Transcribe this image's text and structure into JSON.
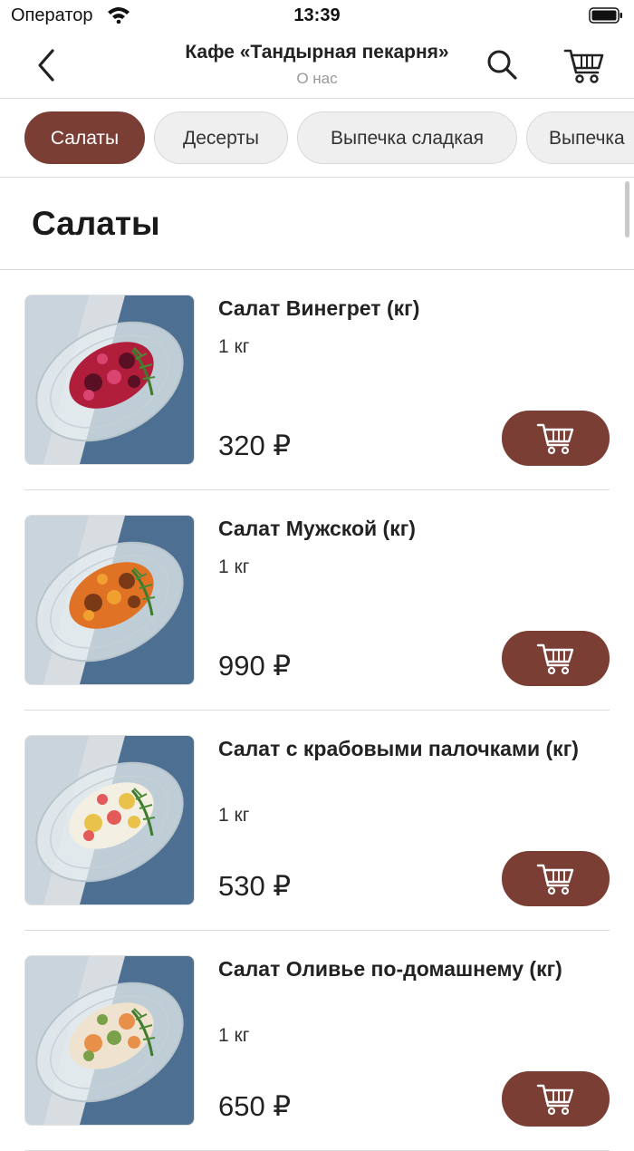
{
  "status_bar": {
    "carrier": "Оператор",
    "time": "13:39"
  },
  "header": {
    "title": "Кафе «Тандырная пекарня»",
    "subtitle": "О нас"
  },
  "tabs": [
    "Салаты",
    "Десерты",
    "Выпечка сладкая",
    "Выпечка"
  ],
  "section": {
    "title": "Салаты"
  },
  "products": [
    {
      "name": "Салат Винегрет (кг)",
      "weight": "1 кг",
      "price": "320 ₽",
      "colors": [
        "#b01e3c",
        "#5a1024",
        "#d94470"
      ]
    },
    {
      "name": "Салат Мужской (кг)",
      "weight": "1 кг",
      "price": "990 ₽",
      "colors": [
        "#e07226",
        "#7a3a18",
        "#f0a030"
      ]
    },
    {
      "name": "Салат с крабовыми палочками (кг)",
      "weight": "1 кг",
      "price": "530 ₽",
      "colors": [
        "#f3efe2",
        "#e8c24a",
        "#e25a5a"
      ]
    },
    {
      "name": "Салат Оливье по-домашнему (кг)",
      "weight": "1 кг",
      "price": "650 ₽",
      "colors": [
        "#efe3cf",
        "#e8904a",
        "#7aa04a"
      ]
    }
  ],
  "icons": {
    "back": "chevron-left-icon",
    "search": "search-icon",
    "cart": "cart-icon"
  },
  "theme": {
    "accent": "#7a3e34",
    "tab_bg": "#efefef",
    "divider": "#d9d9d9"
  }
}
